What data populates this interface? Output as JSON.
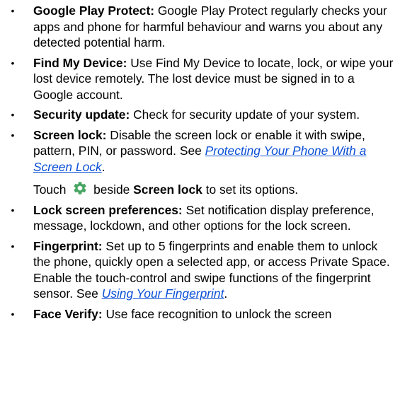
{
  "items": [
    {
      "term": "Google Play Protect:",
      "text": " Google Play Protect regularly checks your apps and phone for harmful behaviour and warns you about any detected potential harm."
    },
    {
      "term": "Find My Device:",
      "text": " Use Find My Device to locate, lock, or wipe your lost device remotely. The lost device must be signed in to a Google account."
    },
    {
      "term": "Security update:",
      "text": " Check for security update of your system."
    },
    {
      "term": "Screen lock:",
      "text": " Disable the screen lock or enable it with swipe, pattern, PIN, or password. See ",
      "link": "Protecting Your Phone With a Screen Lock",
      "after_link": ".",
      "sub": {
        "before_icon": "Touch ",
        "icon": "gear-icon",
        "after_icon": " beside ",
        "bold": "Screen lock",
        "end": " to set its options."
      }
    },
    {
      "term": "Lock screen preferences:",
      "text": " Set notification display preference, message, lockdown, and other options for the lock screen."
    },
    {
      "term": "Fingerprint:",
      "text": " Set up to 5 fingerprints and enable them to unlock the phone, quickly open a selected app, or access Private Space. Enable the touch-control and swipe functions of the fingerprint sensor. See ",
      "link": "Using Your Fingerprint",
      "after_link": "."
    },
    {
      "term": "Face Verify:",
      "text": " Use face recognition to unlock the screen"
    }
  ],
  "colors": {
    "text": "#000000",
    "link": "#0b4fd6",
    "icon": "#4aa564"
  },
  "bullet_glyph": "•"
}
